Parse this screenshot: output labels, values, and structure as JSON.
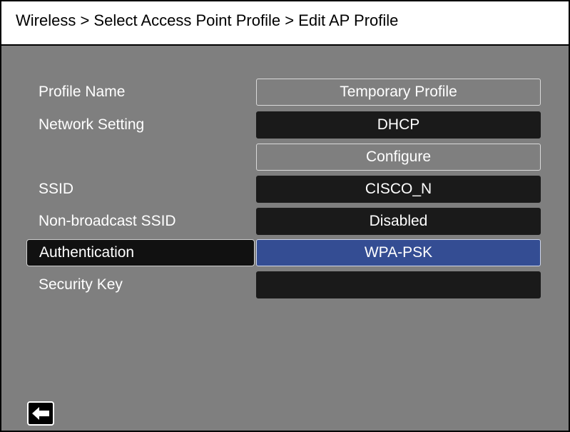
{
  "header": {
    "breadcrumb": "Wireless > Select Access Point Profile > Edit AP Profile"
  },
  "form": {
    "profile_name": {
      "label": "Profile Name",
      "value": "Temporary Profile"
    },
    "network_setting": {
      "label": "Network Setting",
      "value": "DHCP"
    },
    "configure": {
      "label": "",
      "value": "Configure"
    },
    "ssid": {
      "label": "SSID",
      "value": "CISCO_N"
    },
    "non_broadcast_ssid": {
      "label": "Non-broadcast SSID",
      "value": "Disabled"
    },
    "authentication": {
      "label": "Authentication",
      "value": "WPA-PSK"
    },
    "security_key": {
      "label": "Security Key",
      "value": ""
    }
  },
  "footer": {
    "back_icon": "left-arrow-icon"
  },
  "colors": {
    "background": "#7f7f7f",
    "dark_field": "#1a1a1a",
    "selected_field": "#344d93",
    "header_bg": "#ffffff"
  }
}
